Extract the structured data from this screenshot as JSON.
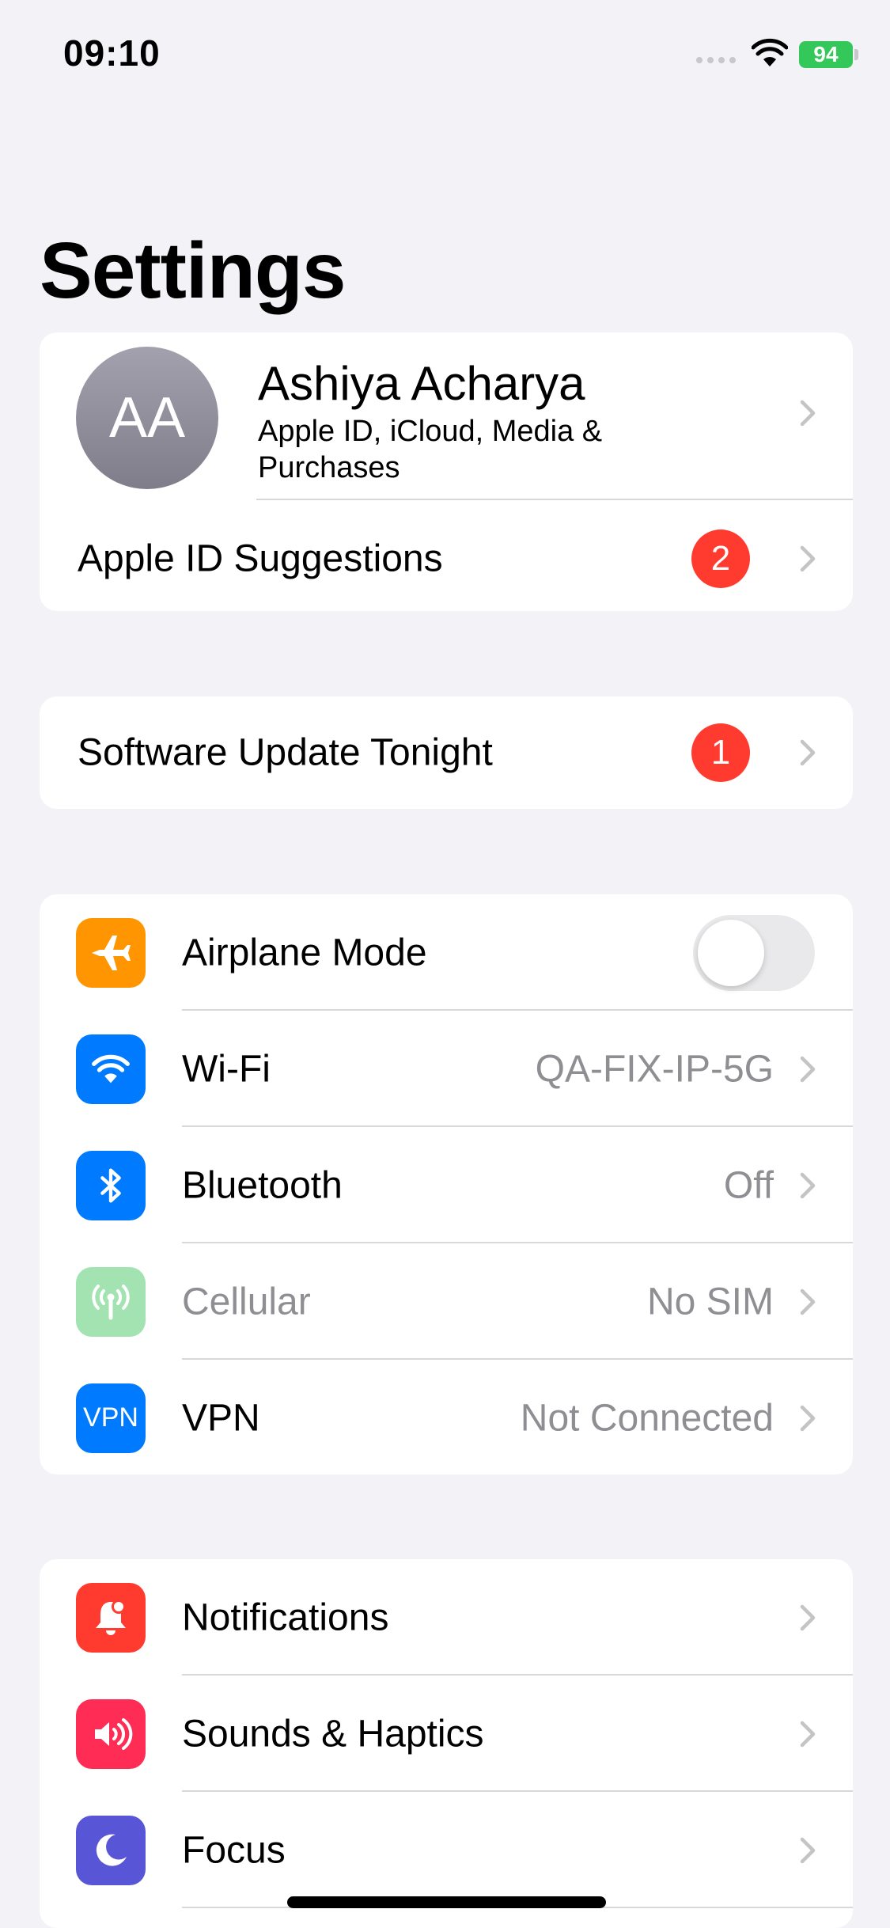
{
  "status_bar": {
    "time": "09:10",
    "battery": "94"
  },
  "title": "Settings",
  "profile": {
    "initials": "AA",
    "name": "Ashiya Acharya",
    "subtitle": "Apple ID, iCloud, Media & Purchases",
    "suggestions_label": "Apple ID Suggestions",
    "suggestions_badge": "2"
  },
  "update": {
    "label": "Software Update Tonight",
    "badge": "1"
  },
  "network": {
    "airplane": {
      "label": "Airplane Mode",
      "enabled": false,
      "icon": "airplane-icon",
      "color": "#ff9500"
    },
    "wifi": {
      "label": "Wi-Fi",
      "value": "QA-FIX-IP-5G",
      "icon": "wifi-icon",
      "color": "#007aff"
    },
    "bluetooth": {
      "label": "Bluetooth",
      "value": "Off",
      "icon": "bluetooth-icon",
      "color": "#007aff"
    },
    "cellular": {
      "label": "Cellular",
      "value": "No SIM",
      "icon": "antenna-icon",
      "color": "#a3e3b2"
    },
    "vpn": {
      "label": "VPN",
      "value": "Not Connected",
      "icon_text": "VPN",
      "color": "#007aff"
    }
  },
  "notifications_group": {
    "notifications": {
      "label": "Notifications",
      "icon": "bell-icon",
      "color": "#ff3b30"
    },
    "sounds": {
      "label": "Sounds & Haptics",
      "icon": "speaker-icon",
      "color": "#ff2d55"
    },
    "focus": {
      "label": "Focus",
      "icon": "moon-icon",
      "color": "#5856d6"
    }
  }
}
